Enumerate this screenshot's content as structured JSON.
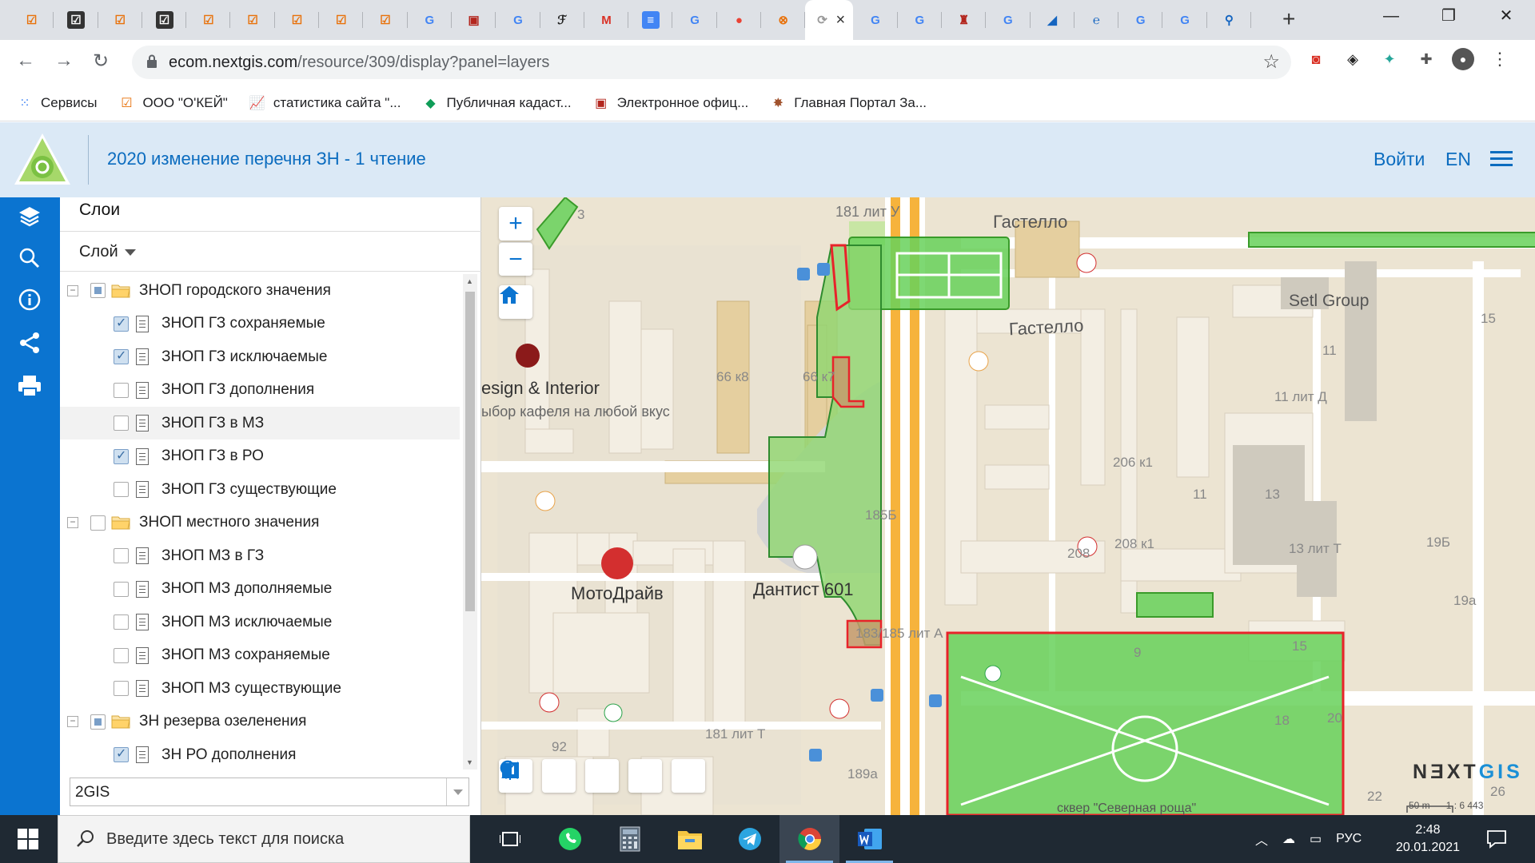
{
  "browser": {
    "tabs": [
      {
        "icon": "checkbox-icon",
        "glyph": "☑",
        "color": "#e8710a",
        "bg": "transparent"
      },
      {
        "icon": "checkbox-dark-icon",
        "glyph": "☑",
        "color": "#fff",
        "bg": "#333"
      },
      {
        "icon": "checkbox-icon",
        "glyph": "☑",
        "color": "#e8710a",
        "bg": "transparent"
      },
      {
        "icon": "checkbox-dark-icon",
        "glyph": "☑",
        "color": "#fff",
        "bg": "#333"
      },
      {
        "icon": "checkbox-icon",
        "glyph": "☑",
        "color": "#e8710a",
        "bg": "transparent"
      },
      {
        "icon": "checkbox-icon",
        "glyph": "☑",
        "color": "#e8710a",
        "bg": "transparent"
      },
      {
        "icon": "checkbox-icon",
        "glyph": "☑",
        "color": "#e8710a",
        "bg": "transparent"
      },
      {
        "icon": "checkbox-icon",
        "glyph": "☑",
        "color": "#e8710a",
        "bg": "transparent"
      },
      {
        "icon": "checkbox-icon",
        "glyph": "☑",
        "color": "#e8710a",
        "bg": "transparent"
      },
      {
        "icon": "google-icon",
        "glyph": "G",
        "color": "#4285f4",
        "bg": "transparent"
      },
      {
        "icon": "coat-of-arms-icon",
        "glyph": "▣",
        "color": "#b3261e",
        "bg": "transparent"
      },
      {
        "icon": "google-icon",
        "glyph": "G",
        "color": "#4285f4",
        "bg": "transparent"
      },
      {
        "icon": "script-icon",
        "glyph": "ℱ",
        "color": "#222",
        "bg": "transparent"
      },
      {
        "icon": "gmail-icon",
        "glyph": "M",
        "color": "#d93025",
        "bg": "transparent"
      },
      {
        "icon": "docs-icon",
        "glyph": "≡",
        "color": "#fff",
        "bg": "#4285f4"
      },
      {
        "icon": "google-icon",
        "glyph": "G",
        "color": "#4285f4",
        "bg": "transparent"
      },
      {
        "icon": "maps-pin-icon",
        "glyph": "●",
        "color": "#ea4335",
        "bg": "transparent"
      },
      {
        "icon": "circle-logo-icon",
        "glyph": "⊗",
        "color": "#e8710a",
        "bg": "transparent"
      },
      {
        "icon": "active-tab-icon",
        "glyph": "⟳",
        "color": "#999",
        "bg": "transparent",
        "active": true
      },
      {
        "icon": "google-icon",
        "glyph": "G",
        "color": "#4285f4",
        "bg": "transparent"
      },
      {
        "icon": "google-icon",
        "glyph": "G",
        "color": "#4285f4",
        "bg": "transparent"
      },
      {
        "icon": "emblem-icon",
        "glyph": "♜",
        "color": "#b3261e",
        "bg": "transparent"
      },
      {
        "icon": "google-icon",
        "glyph": "G",
        "color": "#4285f4",
        "bg": "transparent"
      },
      {
        "icon": "chart-icon",
        "glyph": "◢",
        "color": "#1565c0",
        "bg": "transparent"
      },
      {
        "icon": "edge-icon",
        "glyph": "℮",
        "color": "#1565c0",
        "bg": "transparent"
      },
      {
        "icon": "google-icon",
        "glyph": "G",
        "color": "#4285f4",
        "bg": "transparent"
      },
      {
        "icon": "google-icon",
        "glyph": "G",
        "color": "#4285f4",
        "bg": "transparent"
      },
      {
        "icon": "magnifier-icon",
        "glyph": "⚲",
        "color": "#1565c0",
        "bg": "transparent"
      }
    ],
    "new_tab": "+",
    "window_controls": [
      "—",
      "❐",
      "✕"
    ],
    "url_host": "ecom.nextgis.com",
    "url_path": "/resource/309/display?panel=layers",
    "bookmarks": [
      {
        "icon": "apps-grid-icon",
        "glyph": "⁙",
        "color": "#4285f4",
        "label": "Сервисы"
      },
      {
        "icon": "checkbox-icon",
        "glyph": "☑",
        "color": "#e8710a",
        "label": "ООО \"О'КЕЙ\""
      },
      {
        "icon": "stats-icon",
        "glyph": "📈",
        "color": "#d93025",
        "label": "статистика сайта \"..."
      },
      {
        "icon": "cadastre-icon",
        "glyph": "◆",
        "color": "#0f9d58",
        "label": "Публичная кадаст..."
      },
      {
        "icon": "coat-of-arms-icon",
        "glyph": "▣",
        "color": "#b3261e",
        "label": "Электронное офиц..."
      },
      {
        "icon": "eagle-icon",
        "glyph": "✸",
        "color": "#a0522d",
        "label": "Главная Портал За..."
      }
    ]
  },
  "app": {
    "title": "2020 изменение перечня ЗН - 1 чтение",
    "login": "Войти",
    "lang": "EN"
  },
  "panel": {
    "title": "Слои",
    "column": "Слой",
    "rows": [
      {
        "level": 0,
        "type": "folder",
        "state": "part",
        "label": "ЗНОП городского значения"
      },
      {
        "level": 1,
        "type": "layer",
        "state": "on",
        "label": "ЗНОП ГЗ сохраняемые"
      },
      {
        "level": 1,
        "type": "layer",
        "state": "on",
        "label": "ЗНОП ГЗ исключаемые"
      },
      {
        "level": 1,
        "type": "layer",
        "state": "off",
        "label": "ЗНОП ГЗ дополнения"
      },
      {
        "level": 1,
        "type": "layer",
        "state": "off",
        "label": "ЗНОП ГЗ в МЗ",
        "hl": true
      },
      {
        "level": 1,
        "type": "layer",
        "state": "on",
        "label": "ЗНОП ГЗ в РО"
      },
      {
        "level": 1,
        "type": "layer",
        "state": "off",
        "label": "ЗНОП ГЗ существующие"
      },
      {
        "level": 0,
        "type": "folder",
        "state": "off",
        "label": "ЗНОП местного значения"
      },
      {
        "level": 1,
        "type": "layer",
        "state": "off",
        "label": "ЗНОП МЗ в ГЗ"
      },
      {
        "level": 1,
        "type": "layer",
        "state": "off",
        "label": "ЗНОП МЗ дополняемые"
      },
      {
        "level": 1,
        "type": "layer",
        "state": "off",
        "label": "ЗНОП МЗ исключаемые"
      },
      {
        "level": 1,
        "type": "layer",
        "state": "off",
        "label": "ЗНОП МЗ сохраняемые"
      },
      {
        "level": 1,
        "type": "layer",
        "state": "off",
        "label": "ЗНОП МЗ существующие"
      },
      {
        "level": 0,
        "type": "folder",
        "state": "part",
        "label": "ЗН резерва озеленения"
      },
      {
        "level": 1,
        "type": "layer",
        "state": "on",
        "label": "ЗН РО дополнения"
      }
    ],
    "basemap": "2GIS"
  },
  "map": {
    "labels": {
      "gastello1": "Гастелло",
      "gastello2": "Гастелло",
      "setl": "Setl Group",
      "design": "esign & Interior",
      "kafel": "ыбор кафеля на любой вкус",
      "motodrive": "МотоДрайв",
      "dantist": "Дантист 601",
      "h181u": "181 лит У",
      "h66k8": "66 к8",
      "h66k7": "66 к7",
      "h185b": "185Б",
      "h183": "183/185 лит А",
      "h181t": "181 лит Т",
      "h92": "92",
      "h189a": "189а",
      "h11": "11",
      "h11d": "11 лит Д",
      "h206": "206 к1",
      "h208k": "208 к1",
      "h208": "208",
      "h11b": "11",
      "h13": "13",
      "h13t": "13 лит Т",
      "h19b": "19Б",
      "h19a": "19а",
      "h9": "9",
      "h15": "15",
      "h15b": "15",
      "h18": "18",
      "h20": "20",
      "h22": "22",
      "h26": "26",
      "h3": "3",
      "square": "сквер \"Северная роща\""
    },
    "zoom_in": "+",
    "zoom_out": "−",
    "brand_a": "N",
    "brand_b": "Ǝ",
    "brand_c": "XT",
    "brand_d": "GIS",
    "scale_label": "50 m",
    "scale_ratio": "1 : 6 443"
  },
  "taskbar": {
    "search_placeholder": "Введите здесь текст для поиска",
    "lang": "РУС",
    "time": "2:48",
    "date": "20.01.2021"
  }
}
